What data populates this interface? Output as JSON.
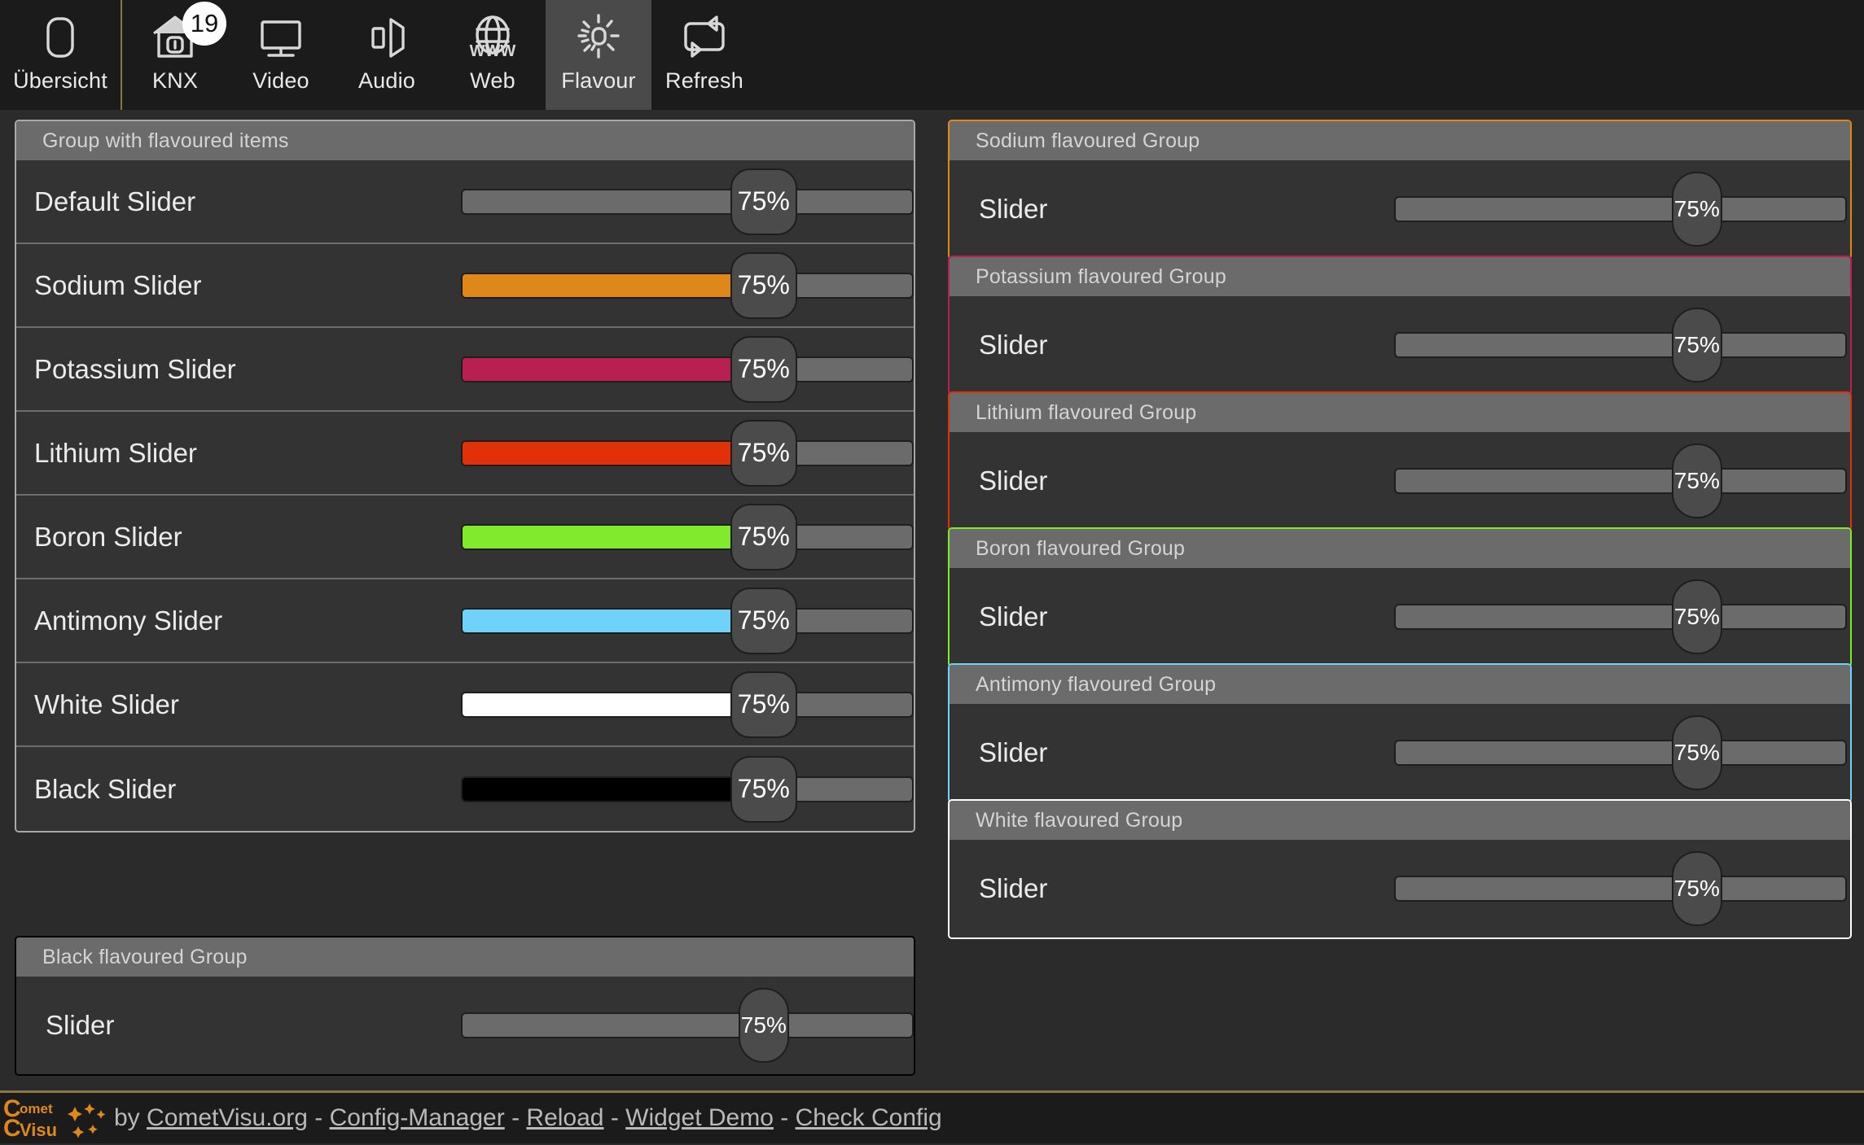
{
  "navbar": {
    "items": [
      {
        "label": "Übersicht",
        "icon": "rounded-rect-icon",
        "active": false,
        "badge": null
      },
      {
        "label": "KNX",
        "icon": "house-switch-icon",
        "active": false,
        "badge": "19"
      },
      {
        "label": "Video",
        "icon": "monitor-icon",
        "active": false,
        "badge": null
      },
      {
        "label": "Audio",
        "icon": "speaker-icon",
        "active": false,
        "badge": null
      },
      {
        "label": "Web",
        "icon": "www-globe-icon",
        "active": false,
        "badge": null
      },
      {
        "label": "Flavour",
        "icon": "sun-icon",
        "active": true,
        "badge": null
      },
      {
        "label": "Refresh",
        "icon": "refresh-loop-icon",
        "active": false,
        "badge": null
      }
    ]
  },
  "left_group": {
    "title": "Group with flavoured items",
    "rows": [
      {
        "label": "Default Slider",
        "value": "75%",
        "fill_color": "#6b6b6b"
      },
      {
        "label": "Sodium Slider",
        "value": "75%",
        "fill_color": "#e0871a"
      },
      {
        "label": "Potassium Slider",
        "value": "75%",
        "fill_color": "#b82052"
      },
      {
        "label": "Lithium Slider",
        "value": "75%",
        "fill_color": "#e23109"
      },
      {
        "label": "Boron Slider",
        "value": "75%",
        "fill_color": "#82ea2d"
      },
      {
        "label": "Antimony Slider",
        "value": "75%",
        "fill_color": "#6fd2f8"
      },
      {
        "label": "White Slider",
        "value": "75%",
        "fill_color": "#ffffff"
      },
      {
        "label": "Black Slider",
        "value": "75%",
        "fill_color": "#000000"
      }
    ]
  },
  "bottom_group": {
    "title": "Black flavoured Group",
    "border_color": "#000000",
    "slider_label": "Slider",
    "value": "75%"
  },
  "right_groups": [
    {
      "title": "Sodium flavoured Group",
      "border_color": "#e0871a",
      "slider_label": "Slider",
      "value": "75%"
    },
    {
      "title": "Potassium flavoured Group",
      "border_color": "#b82052",
      "slider_label": "Slider",
      "value": "75%"
    },
    {
      "title": "Lithium flavoured Group",
      "border_color": "#e23109",
      "slider_label": "Slider",
      "value": "75%"
    },
    {
      "title": "Boron flavoured Group",
      "border_color": "#82ea2d",
      "slider_label": "Slider",
      "value": "75%"
    },
    {
      "title": "Antimony flavoured Group",
      "border_color": "#6fd2f8",
      "slider_label": "Slider",
      "value": "75%"
    },
    {
      "title": "White flavoured Group",
      "border_color": "#ffffff",
      "slider_label": "Slider",
      "value": "75%"
    }
  ],
  "footer": {
    "logo_top": "Comet",
    "logo_bottom": "Visu",
    "by_text": "by",
    "links": [
      "CometVisu.org",
      "Config-Manager",
      "Reload",
      "Widget Demo",
      "Check Config"
    ],
    "separator": "-"
  },
  "colors": {
    "page_bg": "#2b2b2b",
    "navbar_bg": "#1b1b1b",
    "nav_active_bg": "#4a4a4a",
    "group_bg": "#333333",
    "group_title_bg": "#6b6b6b",
    "track_bg": "#6b6b6b",
    "handle_bg": "#4b4b4b",
    "accent": "#e0871a"
  }
}
